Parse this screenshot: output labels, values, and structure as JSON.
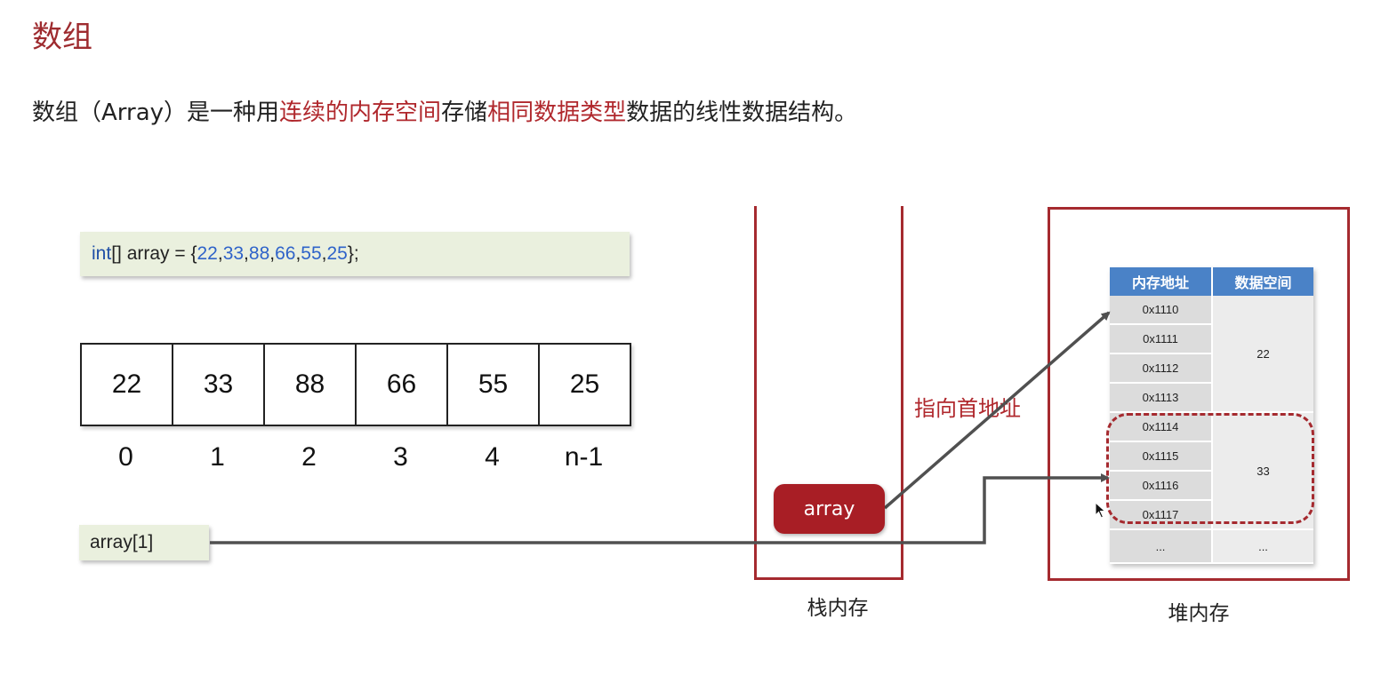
{
  "title": "数组",
  "definition": {
    "part1": "数组（Array）是一种用",
    "hl1": "连续的内存空间",
    "part2": "存储",
    "hl2": "相同数据类型",
    "part3": "数据的线性数据结构。"
  },
  "code": {
    "keyword": "int",
    "decl": "[] array = {",
    "values": [
      "22",
      "33",
      "88",
      "66",
      "55",
      "25"
    ],
    "sep": ",",
    "end": "};"
  },
  "array_cells": [
    "22",
    "33",
    "88",
    "66",
    "55",
    "25"
  ],
  "array_indices": [
    "0",
    "1",
    "2",
    "3",
    "4",
    "n-1"
  ],
  "access_expression": "array[1]",
  "stack": {
    "variable": "array",
    "label": "栈内存"
  },
  "heap": {
    "label": "堆内存",
    "pointer_label": "指向首地址",
    "table": {
      "headers": [
        "内存地址",
        "数据空间"
      ],
      "addresses": [
        "0x1110",
        "0x1111",
        "0x1112",
        "0x1113",
        "0x1114",
        "0x1115",
        "0x1116",
        "0x1117",
        "..."
      ],
      "values": [
        "22",
        "33",
        "..."
      ]
    }
  },
  "colors": {
    "accent_red": "#a52a2f",
    "table_header_blue": "#4a82c7",
    "code_blue": "#2f63c9",
    "code_bg": "#eaf0de"
  }
}
